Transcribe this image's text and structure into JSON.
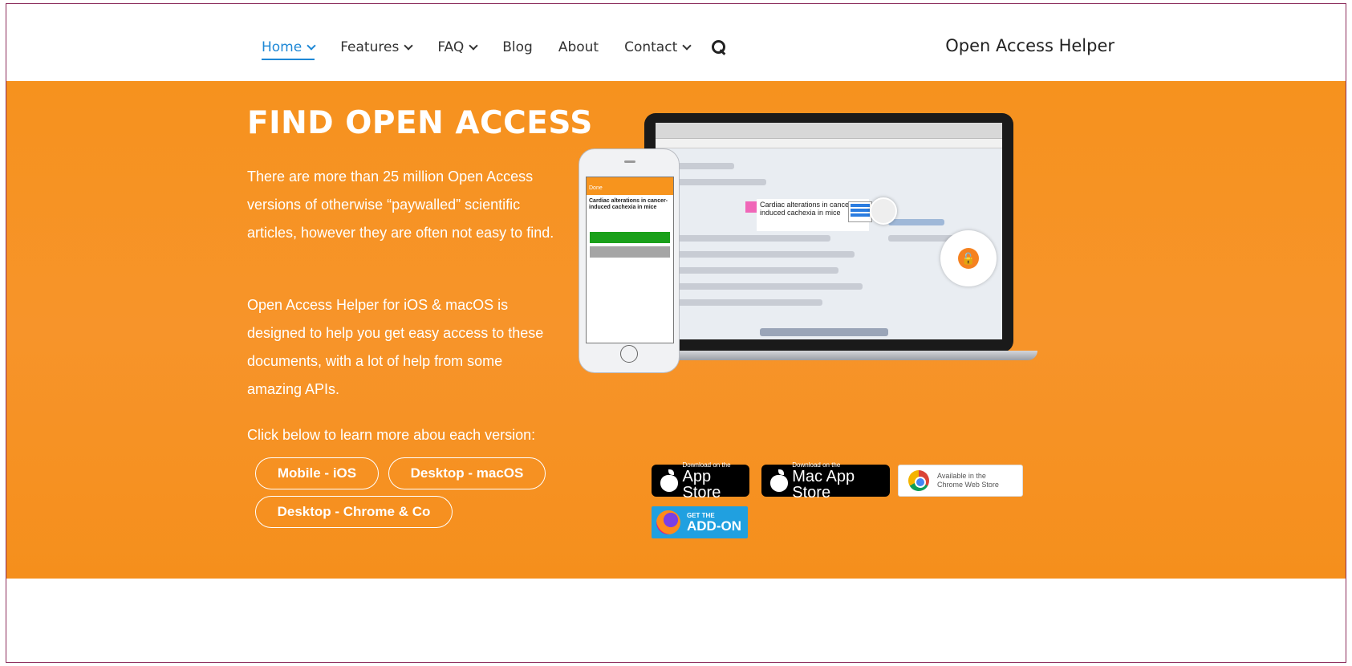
{
  "header": {
    "nav": [
      {
        "label": "Home",
        "has_dropdown": true,
        "active": true
      },
      {
        "label": "Features",
        "has_dropdown": true
      },
      {
        "label": "FAQ",
        "has_dropdown": true
      },
      {
        "label": "Blog",
        "has_dropdown": false
      },
      {
        "label": "About",
        "has_dropdown": false
      },
      {
        "label": "Contact",
        "has_dropdown": true
      }
    ],
    "search_icon": "search-icon",
    "site_title": "Open Access Helper"
  },
  "hero": {
    "title": "FIND OPEN ACCESS",
    "paragraph_1": "There are more than 25 million Open Access versions of otherwise “paywalled” scientific articles, however they are often not easy to find.",
    "paragraph_2": "Open Access Helper for iOS & macOS is designed to help you get easy access to these documents, with a lot of help from some amazing APIs.",
    "paragraph_3": "Click below to learn more abou each version:",
    "buttons": {
      "ios": "Mobile - iOS",
      "macos": "Desktop - macOS",
      "chrome": "Desktop - Chrome & Co"
    },
    "background_color": "#f7941d"
  },
  "screenshot": {
    "article_title": "Cardiac alterations in cancer-induced cachexia in mice",
    "phone_status": "Done"
  },
  "badges": {
    "app_store": {
      "small": "Download on the",
      "big": "App Store"
    },
    "mac_app_store": {
      "small": "Download on the",
      "big": "Mac App Store"
    },
    "chrome_web_store": {
      "small": "Available in the",
      "big": "Chrome Web Store"
    },
    "firefox": {
      "small": "GET THE",
      "big": "ADD-ON"
    }
  }
}
